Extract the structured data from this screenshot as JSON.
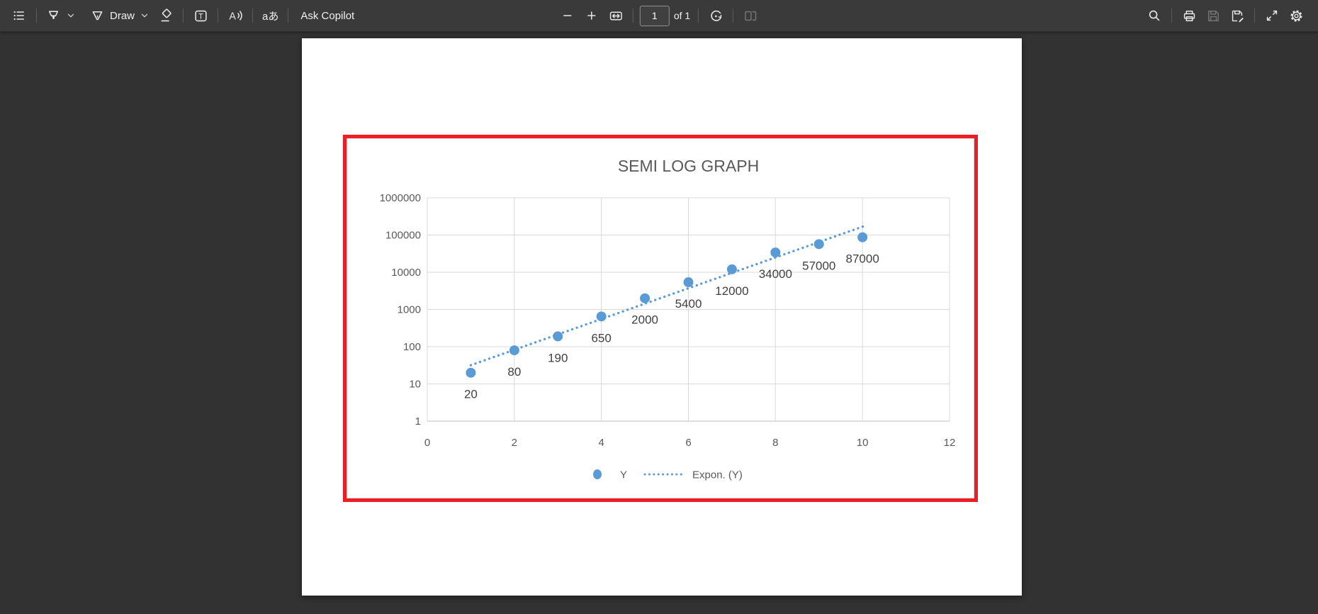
{
  "theme": {
    "toolbar_background": "#3a3a3a",
    "canvas_background": "#323232",
    "icon_color": "#e8e8e8",
    "annotation_red": "#ee1c25"
  },
  "toolbar": {
    "draw_label": "Draw",
    "ask_copilot_label": "Ask Copilot",
    "page_number": "1",
    "page_count_label": "of 1",
    "textbox_glyph": "T",
    "read_aloud_glyph": "A",
    "translate_glyph": "aあ"
  },
  "chart_data": {
    "type": "scatter",
    "title": "SEMI LOG GRAPH",
    "x": [
      1,
      2,
      3,
      4,
      5,
      6,
      7,
      8,
      9,
      10
    ],
    "series": [
      {
        "name": "Y",
        "values": [
          20,
          80,
          190,
          650,
          2000,
          5400,
          12000,
          34000,
          57000,
          87000
        ]
      }
    ],
    "data_labels": [
      "20",
      "80",
      "190",
      "650",
      "2000",
      "5400",
      "12000",
      "34000",
      "57000",
      "87000"
    ],
    "trendline": {
      "name": "Expon. (Y)",
      "type": "exponential",
      "x_start": 1.0,
      "x_end": 10.08
    },
    "x_axis": {
      "min": 0,
      "max": 12,
      "ticks": [
        0,
        2,
        4,
        6,
        8,
        10,
        12
      ]
    },
    "y_axis": {
      "scale": "log",
      "min": 1,
      "max": 1000000,
      "ticks": [
        1,
        10,
        100,
        1000,
        10000,
        100000,
        1000000
      ]
    },
    "legend": {
      "position": "bottom",
      "entries": [
        "Y",
        "Expon. (Y)"
      ]
    },
    "grid": true,
    "colors": {
      "marker": "#5b9bd5",
      "trendline": "#5b9bd5",
      "gridline": "#d9d9d9",
      "axis_line": "#bfbfbf",
      "frame": "#d9d9d9",
      "title": "#595959",
      "axis_text": "#595959",
      "data_label": "#404040",
      "legend_text": "#595959"
    }
  }
}
